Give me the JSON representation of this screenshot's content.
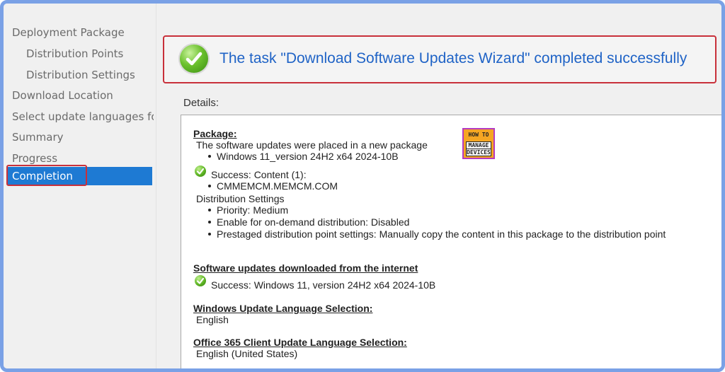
{
  "nav": {
    "items": [
      {
        "label": "Deployment Package",
        "level": 0,
        "selected": false
      },
      {
        "label": "Distribution Points",
        "level": 1,
        "selected": false
      },
      {
        "label": "Distribution Settings",
        "level": 1,
        "selected": false
      },
      {
        "label": "Download Location",
        "level": 0,
        "selected": false
      },
      {
        "label": "Select update languages for",
        "level": 0,
        "selected": false
      },
      {
        "label": "Summary",
        "level": 0,
        "selected": false
      },
      {
        "label": "Progress",
        "level": 0,
        "selected": false
      },
      {
        "label": "Completion",
        "level": 0,
        "selected": true
      }
    ]
  },
  "banner": {
    "message": "The task \"Download Software Updates Wizard\" completed successfully",
    "icon": "success-check-icon"
  },
  "details": {
    "label": "Details:",
    "package_heading": "Package:",
    "package_text": "The software updates were placed in a new package",
    "package_item": "Windows 11_version 24H2 x64 2024-10B",
    "content_success": "Success: Content (1):",
    "content_item": "CMMEMCM.MEMCM.COM",
    "dist_settings_heading": "Distribution Settings",
    "dist_settings": [
      "Priority: Medium",
      "Enable for on-demand distribution: Disabled",
      "Prestaged distribution point settings: Manually copy the content in this package to the distribution point"
    ],
    "downloaded_heading": "Software updates downloaded from the internet",
    "downloaded_success": "Success: Windows 11, version 24H2 x64 2024-10B",
    "wu_lang_heading": "Windows Update Language Selection:",
    "wu_lang_value": "English",
    "o365_lang_heading": "Office 365 Client Update Language Selection:",
    "o365_lang_value": "English (United States)"
  },
  "watermark": {
    "line1": "HOW TO",
    "line2": "MANAGE",
    "line3": "DEVICES",
    "colors": {
      "background": "#f5a623",
      "border": "#b53bc1"
    }
  },
  "colors": {
    "accent": "#1e7ad3",
    "banner_text": "#1f63c6",
    "highlight_border": "#c8303a",
    "frame_border": "#7aa1e6"
  }
}
